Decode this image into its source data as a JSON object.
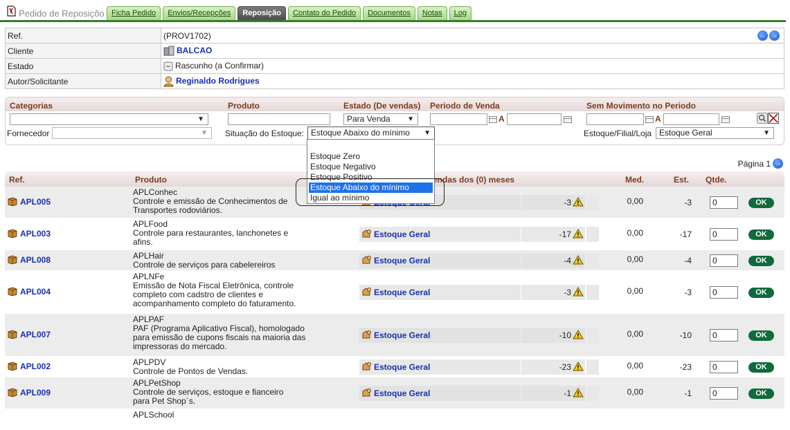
{
  "header": {
    "page_title": "Pedido de Reposiçõo",
    "tabs": [
      {
        "label": "Ficha Pedido",
        "active": false
      },
      {
        "label": "Envios/Recepções",
        "active": false
      },
      {
        "label": "Reposição",
        "active": true
      },
      {
        "label": "Contato do Pedido",
        "active": false
      },
      {
        "label": "Documentos",
        "active": false
      },
      {
        "label": "Notas",
        "active": false
      },
      {
        "label": "Log",
        "active": false
      }
    ]
  },
  "info": {
    "ref_label": "Ref.",
    "ref_value": "(PROV1702)",
    "cliente_label": "Cliente",
    "cliente_value": "BALCAO",
    "estado_label": "Estado",
    "estado_value": "Rascunho (a Confirmar)",
    "autor_label": "Autor/Solicitante",
    "autor_value": "Reginaldo Rodrigues"
  },
  "filters": {
    "categorias_label": "Categorias",
    "categorias_value": "",
    "produto_label": "Produto",
    "produto_value": "",
    "estado_label": "Estado (De vendas)",
    "estado_value": "Para Venda",
    "periodo_label": "Periodo de Venda",
    "a_label": "A",
    "sem_mov_label": "Sem Movimento no Periodo",
    "fornecedor_label": "Fornecedor",
    "fornecedor_value": "",
    "situacao_label": "Situação do Estoque:",
    "situacao_value": "Estoque Abaixo do mínimo",
    "situacao_options": [
      "Estoque Zero",
      "Estoque Negativo",
      "Estoque Positivo",
      "Estoque Abaixo do mínimo",
      "Igual ao mínimo"
    ],
    "situacao_selected_index": 3,
    "estoque_label": "Estoque/Filial/Loja",
    "estoque_value": "Estoque Geral"
  },
  "pagination": {
    "label": "Página 1"
  },
  "table": {
    "columns": {
      "ref": "Ref.",
      "produto": "Produto",
      "vendas": "endas dos (0) meses",
      "med": "Med.",
      "est": "Est.",
      "qtde": "Qtde."
    },
    "rows": [
      {
        "ref": "APL005",
        "name": "APLConhec",
        "desc": [
          "Controle e emissão de Conhecimentos de",
          "Transportes rodoviários."
        ],
        "stock": "Estoque Geral",
        "vendas": "-3",
        "med": "0,00",
        "est": "-3",
        "qtde": "0",
        "ok": "OK"
      },
      {
        "ref": "APL003",
        "name": "APLFood",
        "desc": [
          "Controle para restaurantes, lanchonetes e",
          "afins."
        ],
        "stock": "Estoque Geral",
        "vendas": "-17",
        "med": "0,00",
        "est": "-17",
        "qtde": "0",
        "ok": "OK"
      },
      {
        "ref": "APL008",
        "name": "APLHair",
        "desc": [
          "Controle de serviços para cabelereiros"
        ],
        "stock": "Estoque Geral",
        "vendas": "-4",
        "med": "0,00",
        "est": "-4",
        "qtde": "0",
        "ok": "OK"
      },
      {
        "ref": "APL004",
        "name": "APLNFe",
        "desc": [
          "Emissão de Nota Fiscal Eletrônica, controle",
          "completo com cadstro de clientes e",
          "acompanhamento completo do faturamento."
        ],
        "stock": "Estoque Geral",
        "vendas": "-3",
        "med": "0,00",
        "est": "-3",
        "qtde": "0",
        "ok": "OK"
      },
      {
        "ref": "APL007",
        "name": "APLPAF",
        "desc": [
          "PAF (Programa Aplicativo Fiscal), homologado",
          "para emissão de cupons fiscais na maioria das",
          "impressoras do mercado."
        ],
        "stock": "Estoque Geral",
        "vendas": "-10",
        "med": "0,00",
        "est": "-10",
        "qtde": "0",
        "ok": "OK"
      },
      {
        "ref": "APL002",
        "name": "APLPDV",
        "desc": [
          "Controle de Pontos de Vendas."
        ],
        "stock": "Estoque Geral",
        "vendas": "-23",
        "med": "0,00",
        "est": "-23",
        "qtde": "0",
        "ok": "OK"
      },
      {
        "ref": "APL009",
        "name": "APLPetShop",
        "desc": [
          "Controle de serviços, estoque e fianceiro",
          "para Pet Shop´s."
        ],
        "stock": "Estoque Geral",
        "vendas": "-1",
        "med": "0,00",
        "est": "-1",
        "qtde": "0",
        "ok": "OK"
      },
      {
        "ref": "",
        "name": "APLSchool",
        "desc": [],
        "stock": "",
        "vendas": "",
        "med": "",
        "est": "",
        "qtde": "",
        "ok": ""
      }
    ]
  }
}
